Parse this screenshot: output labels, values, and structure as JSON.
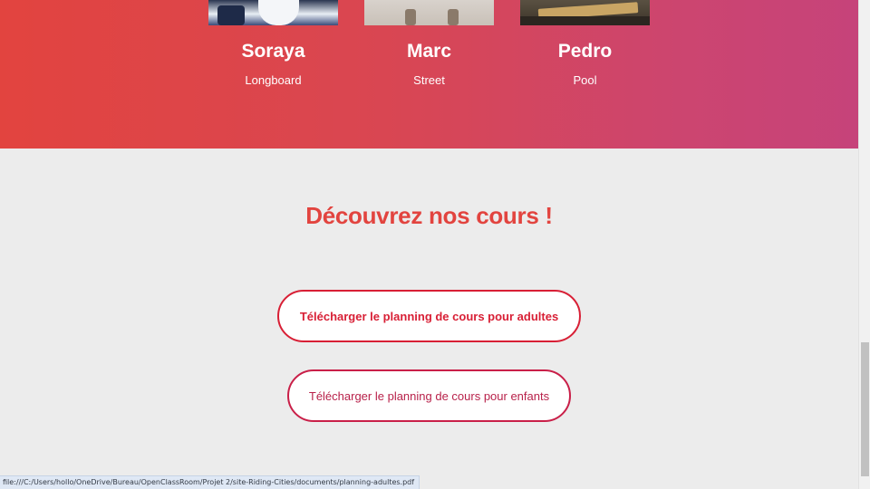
{
  "team": {
    "members": [
      {
        "name": "Soraya",
        "style": "Longboard",
        "photo": "soraya-photo"
      },
      {
        "name": "Marc",
        "style": "Street",
        "photo": "marc-photo"
      },
      {
        "name": "Pedro",
        "style": "Pool",
        "photo": "pedro-photo"
      }
    ]
  },
  "courses": {
    "title": "Découvrez nos cours !",
    "buttons": {
      "adults": "Télécharger le planning de cours pour adultes",
      "children": "Télécharger le planning de cours pour enfants"
    }
  },
  "status_bar": {
    "url": "file:///C:/Users/hollo/OneDrive/Bureau/OpenClassRoom/Projet 2/site-Riding-Cities/documents/planning-adultes.pdf"
  },
  "colors": {
    "accent": "#e2443f",
    "button_border": "#d81f35",
    "background": "#ececec",
    "gradient_start": "#e2443f",
    "gradient_end": "#c6437a"
  }
}
